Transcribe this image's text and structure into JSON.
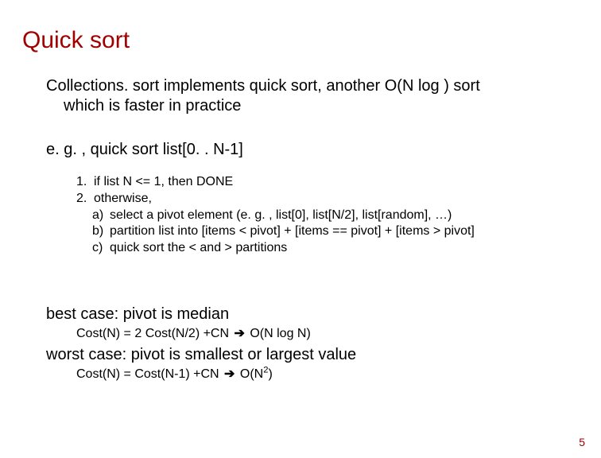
{
  "title": "Quick sort",
  "intro": {
    "line1": "Collections. sort implements quick sort, another O(N log ) sort",
    "line2": "which is faster in practice"
  },
  "example": "e. g. , quick sort list[0. . N-1]",
  "steps": [
    {
      "num": "1.",
      "text": "if list N <= 1, then DONE"
    },
    {
      "num": "2.",
      "text": "otherwise,"
    }
  ],
  "substeps": [
    {
      "num": "a)",
      "text": "select a pivot element (e. g. , list[0], list[N/2], list[random], …)"
    },
    {
      "num": "b)",
      "text": "partition list into [items < pivot] + [items == pivot] + [items > pivot]"
    },
    {
      "num": "c)",
      "text": "quick sort the < and > partitions"
    }
  ],
  "best_case": {
    "label": "best case: pivot is median",
    "cost_left": "Cost(N) = 2 Cost(N/2) +CN ",
    "arrow": "➔",
    "cost_right": " O(N log N)"
  },
  "worst_case": {
    "label": "worst case: pivot is smallest or largest value",
    "cost_left": "Cost(N) = Cost(N-1) +CN ",
    "arrow": "➔",
    "cost_right_prefix": " O(N",
    "cost_right_sup": "2",
    "cost_right_suffix": ")"
  },
  "page_number": "5"
}
